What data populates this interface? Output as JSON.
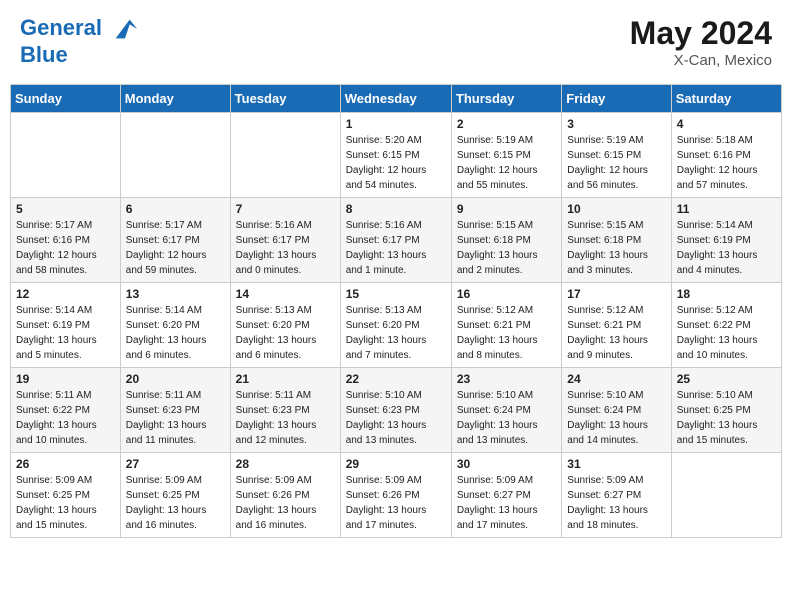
{
  "header": {
    "logo_line1": "General",
    "logo_line2": "Blue",
    "month": "May 2024",
    "location": "X-Can, Mexico"
  },
  "weekdays": [
    "Sunday",
    "Monday",
    "Tuesday",
    "Wednesday",
    "Thursday",
    "Friday",
    "Saturday"
  ],
  "weeks": [
    [
      {
        "day": "",
        "info": ""
      },
      {
        "day": "",
        "info": ""
      },
      {
        "day": "",
        "info": ""
      },
      {
        "day": "1",
        "info": "Sunrise: 5:20 AM\nSunset: 6:15 PM\nDaylight: 12 hours\nand 54 minutes."
      },
      {
        "day": "2",
        "info": "Sunrise: 5:19 AM\nSunset: 6:15 PM\nDaylight: 12 hours\nand 55 minutes."
      },
      {
        "day": "3",
        "info": "Sunrise: 5:19 AM\nSunset: 6:15 PM\nDaylight: 12 hours\nand 56 minutes."
      },
      {
        "day": "4",
        "info": "Sunrise: 5:18 AM\nSunset: 6:16 PM\nDaylight: 12 hours\nand 57 minutes."
      }
    ],
    [
      {
        "day": "5",
        "info": "Sunrise: 5:17 AM\nSunset: 6:16 PM\nDaylight: 12 hours\nand 58 minutes."
      },
      {
        "day": "6",
        "info": "Sunrise: 5:17 AM\nSunset: 6:17 PM\nDaylight: 12 hours\nand 59 minutes."
      },
      {
        "day": "7",
        "info": "Sunrise: 5:16 AM\nSunset: 6:17 PM\nDaylight: 13 hours\nand 0 minutes."
      },
      {
        "day": "8",
        "info": "Sunrise: 5:16 AM\nSunset: 6:17 PM\nDaylight: 13 hours\nand 1 minute."
      },
      {
        "day": "9",
        "info": "Sunrise: 5:15 AM\nSunset: 6:18 PM\nDaylight: 13 hours\nand 2 minutes."
      },
      {
        "day": "10",
        "info": "Sunrise: 5:15 AM\nSunset: 6:18 PM\nDaylight: 13 hours\nand 3 minutes."
      },
      {
        "day": "11",
        "info": "Sunrise: 5:14 AM\nSunset: 6:19 PM\nDaylight: 13 hours\nand 4 minutes."
      }
    ],
    [
      {
        "day": "12",
        "info": "Sunrise: 5:14 AM\nSunset: 6:19 PM\nDaylight: 13 hours\nand 5 minutes."
      },
      {
        "day": "13",
        "info": "Sunrise: 5:14 AM\nSunset: 6:20 PM\nDaylight: 13 hours\nand 6 minutes."
      },
      {
        "day": "14",
        "info": "Sunrise: 5:13 AM\nSunset: 6:20 PM\nDaylight: 13 hours\nand 6 minutes."
      },
      {
        "day": "15",
        "info": "Sunrise: 5:13 AM\nSunset: 6:20 PM\nDaylight: 13 hours\nand 7 minutes."
      },
      {
        "day": "16",
        "info": "Sunrise: 5:12 AM\nSunset: 6:21 PM\nDaylight: 13 hours\nand 8 minutes."
      },
      {
        "day": "17",
        "info": "Sunrise: 5:12 AM\nSunset: 6:21 PM\nDaylight: 13 hours\nand 9 minutes."
      },
      {
        "day": "18",
        "info": "Sunrise: 5:12 AM\nSunset: 6:22 PM\nDaylight: 13 hours\nand 10 minutes."
      }
    ],
    [
      {
        "day": "19",
        "info": "Sunrise: 5:11 AM\nSunset: 6:22 PM\nDaylight: 13 hours\nand 10 minutes."
      },
      {
        "day": "20",
        "info": "Sunrise: 5:11 AM\nSunset: 6:23 PM\nDaylight: 13 hours\nand 11 minutes."
      },
      {
        "day": "21",
        "info": "Sunrise: 5:11 AM\nSunset: 6:23 PM\nDaylight: 13 hours\nand 12 minutes."
      },
      {
        "day": "22",
        "info": "Sunrise: 5:10 AM\nSunset: 6:23 PM\nDaylight: 13 hours\nand 13 minutes."
      },
      {
        "day": "23",
        "info": "Sunrise: 5:10 AM\nSunset: 6:24 PM\nDaylight: 13 hours\nand 13 minutes."
      },
      {
        "day": "24",
        "info": "Sunrise: 5:10 AM\nSunset: 6:24 PM\nDaylight: 13 hours\nand 14 minutes."
      },
      {
        "day": "25",
        "info": "Sunrise: 5:10 AM\nSunset: 6:25 PM\nDaylight: 13 hours\nand 15 minutes."
      }
    ],
    [
      {
        "day": "26",
        "info": "Sunrise: 5:09 AM\nSunset: 6:25 PM\nDaylight: 13 hours\nand 15 minutes."
      },
      {
        "day": "27",
        "info": "Sunrise: 5:09 AM\nSunset: 6:25 PM\nDaylight: 13 hours\nand 16 minutes."
      },
      {
        "day": "28",
        "info": "Sunrise: 5:09 AM\nSunset: 6:26 PM\nDaylight: 13 hours\nand 16 minutes."
      },
      {
        "day": "29",
        "info": "Sunrise: 5:09 AM\nSunset: 6:26 PM\nDaylight: 13 hours\nand 17 minutes."
      },
      {
        "day": "30",
        "info": "Sunrise: 5:09 AM\nSunset: 6:27 PM\nDaylight: 13 hours\nand 17 minutes."
      },
      {
        "day": "31",
        "info": "Sunrise: 5:09 AM\nSunset: 6:27 PM\nDaylight: 13 hours\nand 18 minutes."
      },
      {
        "day": "",
        "info": ""
      }
    ]
  ]
}
